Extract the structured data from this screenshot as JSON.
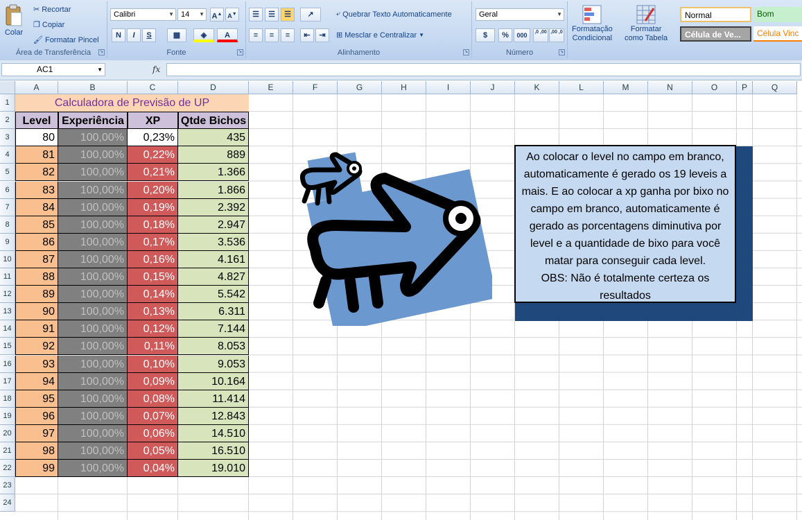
{
  "ribbon": {
    "clipboard": {
      "paste": "Colar",
      "cut": "Recortar",
      "copy": "Copiar",
      "format_painter": "Formatar Pincel",
      "label": "Área de Transferência"
    },
    "font": {
      "name": "Calibri",
      "size": "14",
      "bold": "N",
      "italic": "I",
      "underline": "S",
      "label": "Fonte"
    },
    "alignment": {
      "wrap": "Quebrar Texto Automaticamente",
      "merge": "Mesclar e Centralizar",
      "label": "Alinhamento"
    },
    "number": {
      "format": "Geral",
      "percent": "%",
      "thousands": "000",
      "inc_dec": ",0 ,00",
      "dec_dec": ",00 ,0",
      "label": "Número"
    },
    "styles": {
      "cond_format_1": "Formatação",
      "cond_format_2": "Condicional",
      "format_table_1": "Formatar",
      "format_table_2": "como Tabela",
      "normal": "Normal",
      "bom": "Bom",
      "celula_ve": "Célula de Ve...",
      "celula_vinc": "Célula Vinc"
    }
  },
  "formula_bar": {
    "name_box": "AC1",
    "fx": "fx",
    "value": ""
  },
  "columns": [
    "A",
    "B",
    "C",
    "D",
    "E",
    "F",
    "G",
    "H",
    "I",
    "J",
    "K",
    "L",
    "M",
    "N",
    "O",
    "P",
    "Q"
  ],
  "rows": [
    "1",
    "2",
    "3",
    "4",
    "5",
    "6",
    "7",
    "8",
    "9",
    "10",
    "11",
    "12",
    "13",
    "14",
    "15",
    "16",
    "17",
    "18",
    "19",
    "20",
    "21",
    "22",
    "23",
    "24"
  ],
  "sheet": {
    "title": "Calculadora de Previsão de UP",
    "headers": [
      "Level",
      "Experiência",
      "XP",
      "Qtde Bichos"
    ],
    "data": [
      [
        "80",
        "100,00%",
        "0,23%",
        "435"
      ],
      [
        "81",
        "100,00%",
        "0,22%",
        "889"
      ],
      [
        "82",
        "100,00%",
        "0,21%",
        "1.366"
      ],
      [
        "83",
        "100,00%",
        "0,20%",
        "1.866"
      ],
      [
        "84",
        "100,00%",
        "0,19%",
        "2.392"
      ],
      [
        "85",
        "100,00%",
        "0,18%",
        "2.947"
      ],
      [
        "86",
        "100,00%",
        "0,17%",
        "3.536"
      ],
      [
        "87",
        "100,00%",
        "0,16%",
        "4.161"
      ],
      [
        "88",
        "100,00%",
        "0,15%",
        "4.827"
      ],
      [
        "89",
        "100,00%",
        "0,14%",
        "5.542"
      ],
      [
        "90",
        "100,00%",
        "0,13%",
        "6.311"
      ],
      [
        "91",
        "100,00%",
        "0,12%",
        "7.144"
      ],
      [
        "92",
        "100,00%",
        "0,11%",
        "8.053"
      ],
      [
        "93",
        "100,00%",
        "0,10%",
        "9.053"
      ],
      [
        "94",
        "100,00%",
        "0,09%",
        "10.164"
      ],
      [
        "95",
        "100,00%",
        "0,08%",
        "11.414"
      ],
      [
        "96",
        "100,00%",
        "0,07%",
        "12.843"
      ],
      [
        "97",
        "100,00%",
        "0,06%",
        "14.510"
      ],
      [
        "98",
        "100,00%",
        "0,05%",
        "16.510"
      ],
      [
        "99",
        "100,00%",
        "0,04%",
        "19.010"
      ]
    ]
  },
  "note": {
    "text": "Ao colocar o level no campo em branco, automaticamente é gerado os  19 leveis a mais. E ao colocar a xp ganha por bixo no campo em branco, automaticamente é gerado as porcentagens diminutiva por level e a quantidade de bixo para você matar para conseguir cada level.",
    "obs": "OBS: Não é totalmente certeza os resultados"
  },
  "colors": {
    "orange": "#fabf8f",
    "gray": "#808080",
    "red": "#d0595a",
    "green": "#d8e4bc",
    "lavender": "#ccc0da",
    "title_bg": "#fcd5b4",
    "title_text": "#7030a0",
    "note_bg": "#c5d9f1",
    "note_shadow": "#1f497d"
  }
}
